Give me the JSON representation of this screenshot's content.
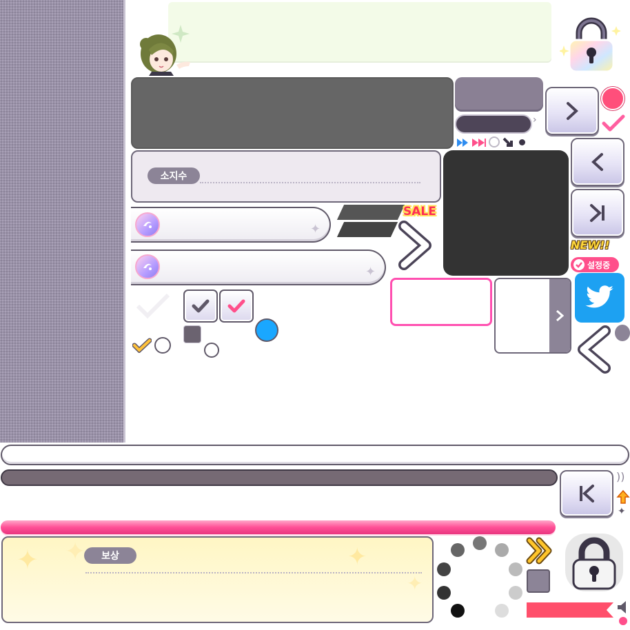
{
  "labels": {
    "owned_count": "소지수",
    "reward": "보상",
    "sale_badge": "SALE",
    "new_badge": "NEW!!",
    "setting_badge": "설정중"
  },
  "icons": {
    "lock_colored": "lock-icon",
    "lock_gray": "lock-icon",
    "twitter": "twitter-icon",
    "chevron_right": "chevron-right-icon",
    "chevron_left": "chevron-left-icon",
    "skip_end": "skip-to-end-icon",
    "skip_start": "skip-to-start-icon",
    "check": "check-icon",
    "fast_forward": "fast-forward-icon",
    "arrow_up": "arrow-up-icon",
    "speaker": "speaker-icon"
  },
  "colors": {
    "accent_pink": "#ff4f8b",
    "twitter_blue": "#1da1f2",
    "panel_gray": "#666666",
    "panel_dark": "#333333",
    "muted_purple": "#8c8497"
  }
}
